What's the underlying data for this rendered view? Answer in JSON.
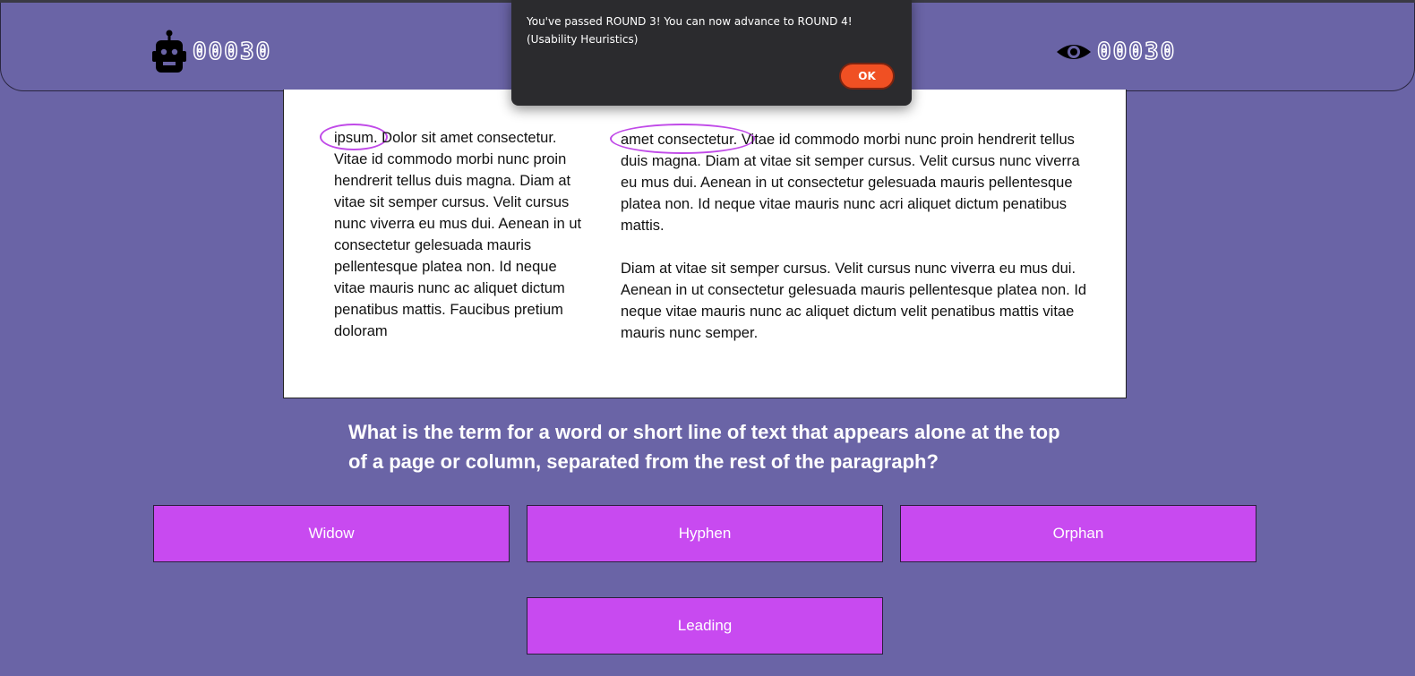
{
  "header": {
    "robot_score": "00030",
    "view_score": "00030"
  },
  "article": {
    "column1": "ipsum. Dolor sit amet consectetur. Vitae id commodo morbi nunc proin hendrerit tellus duis magna. Diam at vitae sit semper cursus. Velit cursus nunc viverra eu mus dui. Aenean in ut consectetur gelesuada mauris pellentesque platea non. Id neque vitae mauris nunc ac aliquet dictum penatibus mattis. Faucibus pretium doloram",
    "column2_p1": "amet consectetur. Vitae id commodo morbi nunc proin hendrerit tellus duis magna. Diam at vitae sit semper cursus. Velit cursus nunc viverra eu mus dui. Aenean in ut consectetur gelesuada mauris pellentesque platea non. Id neque vitae mauris nunc acri aliquet dictum penatibus mattis.",
    "column2_p2": "Diam at vitae sit semper cursus. Velit cursus nunc viverra eu mus dui. Aenean in ut consectetur gelesuada mauris pellentesque platea non. Id neque vitae mauris nunc ac aliquet dictum velit penatibus mattis vitae mauris nunc semper."
  },
  "question": "What is the term for a word or short line of text that appears alone at the top of a page or column, separated from the rest of the paragraph?",
  "answers": [
    "Widow",
    "Hyphen",
    "Orphan",
    "Leading"
  ],
  "dialog": {
    "message": "You've passed ROUND 3! You can now advance to ROUND 4! (Usability Heuristics)",
    "ok_label": "OK"
  },
  "colors": {
    "background": "#6a64a6",
    "answer_button": "#c84af0",
    "highlight_circle": "#c04ae8",
    "ok_button": "#f05023",
    "dialog_background": "#2b2b2e"
  },
  "icons": {
    "left_score": "robot-icon",
    "right_score": "eye-icon"
  }
}
